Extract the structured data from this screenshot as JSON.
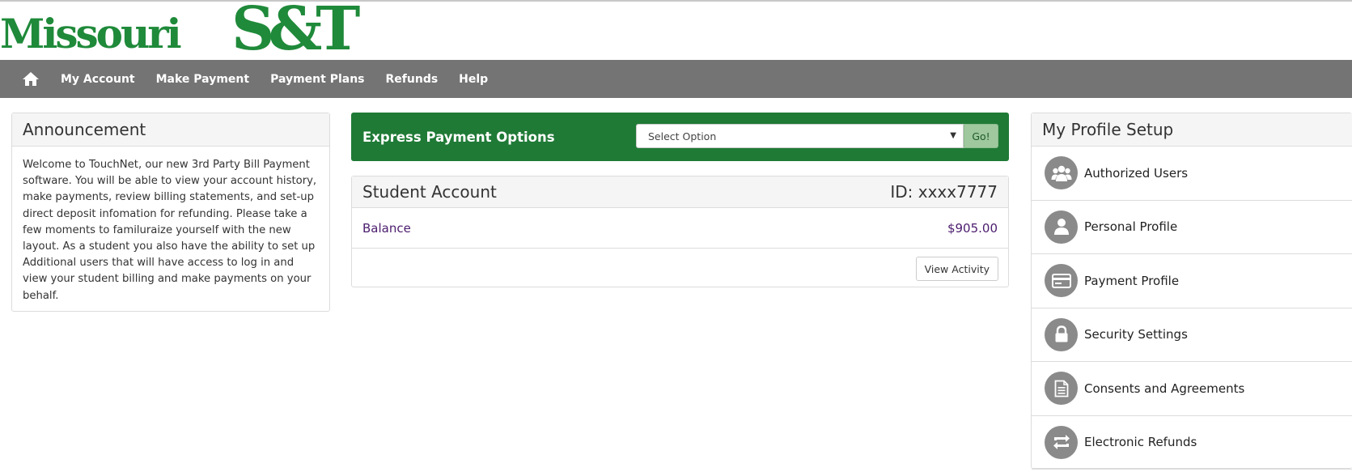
{
  "logo": {
    "name": "Missouri",
    "suffix": "S&T"
  },
  "nav": {
    "home_icon": "home-icon",
    "items": [
      "My Account",
      "Make Payment",
      "Payment Plans",
      "Refunds",
      "Help"
    ]
  },
  "announcement": {
    "title": "Announcement",
    "body": "Welcome to TouchNet, our new 3rd Party Bill Payment software.  You will be able to view your account history, make payments, review billing statements, and set-up direct deposit infomation for refunding.  Please take a few moments to familuraize yourself with the new layout.  As a student you also have the ability to set up Additional users that will have access to log in and view your student billing and make payments on your behalf."
  },
  "express": {
    "title": "Express Payment Options",
    "select_value": "Select Option",
    "go_label": "Go!"
  },
  "student_account": {
    "title": "Student Account",
    "id_text": "ID: xxxx7777",
    "balance_label": "Balance",
    "balance_value": "$905.00",
    "view_activity_label": "View Activity"
  },
  "profile": {
    "title": "My Profile Setup",
    "items": [
      {
        "label": "Authorized Users",
        "icon": "users-icon"
      },
      {
        "label": "Personal Profile",
        "icon": "user-icon"
      },
      {
        "label": "Payment Profile",
        "icon": "credit-card-icon"
      },
      {
        "label": "Security Settings",
        "icon": "lock-icon"
      },
      {
        "label": "Consents and Agreements",
        "icon": "document-icon"
      },
      {
        "label": "Electronic Refunds",
        "icon": "refund-arrows-icon"
      }
    ]
  },
  "colors": {
    "brand_green": "#1f8a3a",
    "express_green": "#1f7a36",
    "nav_gray": "#747474",
    "link_purple": "#4b1c6e"
  }
}
